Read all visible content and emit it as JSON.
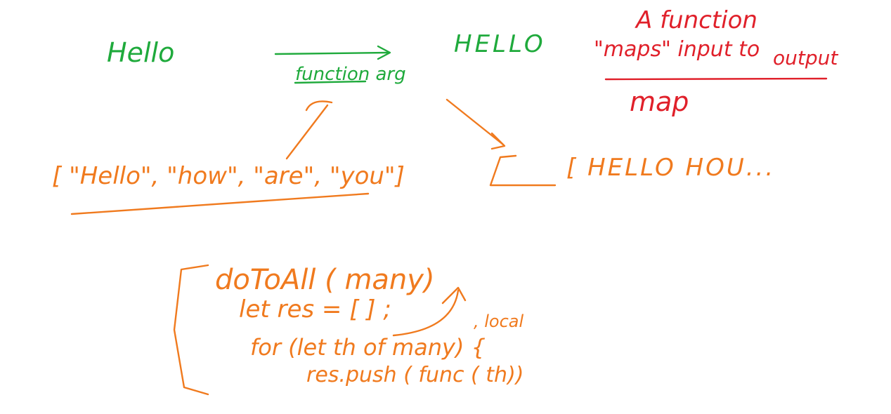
{
  "colors": {
    "green": "#1faa3c",
    "red": "#e0202a",
    "orange": "#f07a1e",
    "background": "#ffffff"
  },
  "top_row": {
    "input_word": "Hello",
    "arrow_label": "function arg",
    "output_word": "HELLO"
  },
  "definition": {
    "line1": "A function",
    "line2": "\"maps\" input to",
    "line3": "output",
    "term": "map"
  },
  "array_in": {
    "text": "[ \"Hello\", \"how\", \"are\", \"you\"]"
  },
  "array_out": {
    "text": "[ HELLO HOU..."
  },
  "code": {
    "line1": "doToAll ( many)",
    "line2": "let res = [ ] ;",
    "line3": "for (let th of many) {",
    "line4": "res.push ( func ( th))",
    "annotation": ", local"
  }
}
